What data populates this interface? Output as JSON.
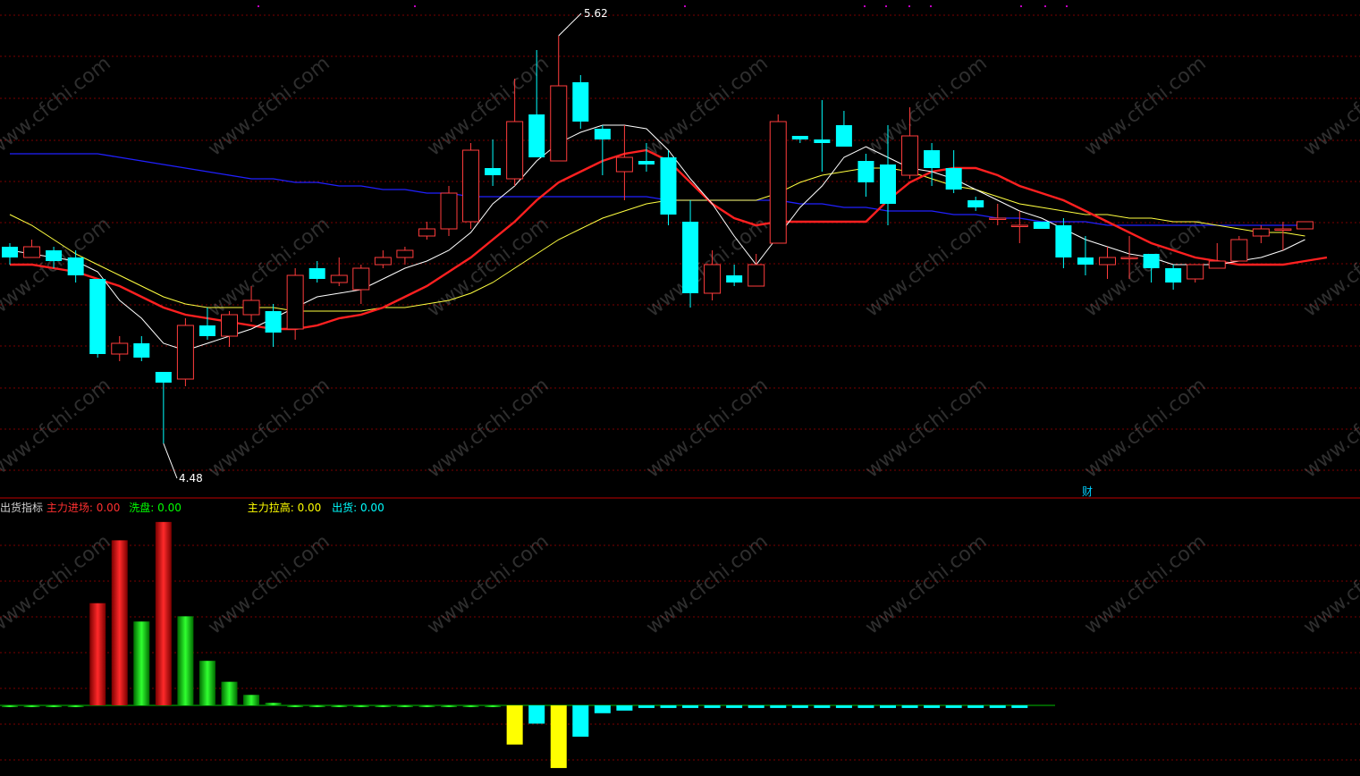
{
  "colors": {
    "background": "#000000",
    "bull_candle": "#ff3c3c",
    "bear_candle": "#00ffff",
    "ma_white": "#ffffff",
    "ma_red": "#ff2020",
    "ma_yellow": "#ffff40",
    "ma_blue": "#2020ff",
    "grid": "#7a0000",
    "divider": "#c00000",
    "osc_red": "#e00000",
    "osc_green": "#00d000",
    "osc_yellow": "#ffff00",
    "osc_cyan": "#00ffff",
    "text_red": "#ff3030",
    "text_green": "#00ff00",
    "text_yellow": "#ffff00",
    "text_cyan": "#00ffff",
    "text_white": "#d0d0d0"
  },
  "watermark": "www.cfchi.com",
  "indicator": {
    "name": "出货指标",
    "main_entry_label": "主力进场:",
    "main_entry_value": "0.00",
    "wash_label": "洗盘:",
    "wash_value": "0.00",
    "pull_up_label": "主力拉高:",
    "pull_up_value": "0.00",
    "ship_label": "出货:",
    "ship_value": "0.00"
  },
  "annotations": {
    "high_label": "5.62",
    "low_label": "4.48",
    "finance_marker": "财"
  },
  "chart_data": [
    {
      "type": "candlestick",
      "ylim": [
        4.35,
        5.7
      ],
      "candles": [
        {
          "o": 5.03,
          "h": 5.04,
          "l": 4.98,
          "c": 5.0
        },
        {
          "o": 5.0,
          "h": 5.05,
          "l": 5.0,
          "c": 5.03
        },
        {
          "o": 5.02,
          "h": 5.03,
          "l": 4.97,
          "c": 4.99
        },
        {
          "o": 5.0,
          "h": 5.02,
          "l": 4.93,
          "c": 4.95
        },
        {
          "o": 4.94,
          "h": 4.94,
          "l": 4.72,
          "c": 4.73
        },
        {
          "o": 4.73,
          "h": 4.78,
          "l": 4.71,
          "c": 4.76
        },
        {
          "o": 4.76,
          "h": 4.78,
          "l": 4.71,
          "c": 4.72
        },
        {
          "o": 4.68,
          "h": 4.68,
          "l": 4.48,
          "c": 4.65
        },
        {
          "o": 4.66,
          "h": 4.83,
          "l": 4.64,
          "c": 4.81
        },
        {
          "o": 4.81,
          "h": 4.86,
          "l": 4.77,
          "c": 4.78
        },
        {
          "o": 4.78,
          "h": 4.85,
          "l": 4.75,
          "c": 4.84
        },
        {
          "o": 4.84,
          "h": 4.92,
          "l": 4.82,
          "c": 4.88
        },
        {
          "o": 4.85,
          "h": 4.87,
          "l": 4.75,
          "c": 4.79
        },
        {
          "o": 4.8,
          "h": 4.97,
          "l": 4.77,
          "c": 4.95
        },
        {
          "o": 4.97,
          "h": 4.99,
          "l": 4.93,
          "c": 4.94
        },
        {
          "o": 4.93,
          "h": 5.0,
          "l": 4.92,
          "c": 4.95
        },
        {
          "o": 4.91,
          "h": 4.98,
          "l": 4.87,
          "c": 4.97
        },
        {
          "o": 4.98,
          "h": 5.02,
          "l": 4.97,
          "c": 5.0
        },
        {
          "o": 5.0,
          "h": 5.03,
          "l": 4.98,
          "c": 5.02
        },
        {
          "o": 5.06,
          "h": 5.1,
          "l": 5.05,
          "c": 5.08
        },
        {
          "o": 5.08,
          "h": 5.2,
          "l": 5.06,
          "c": 5.18
        },
        {
          "o": 5.1,
          "h": 5.32,
          "l": 5.08,
          "c": 5.3
        },
        {
          "o": 5.25,
          "h": 5.33,
          "l": 5.2,
          "c": 5.23
        },
        {
          "o": 5.22,
          "h": 5.5,
          "l": 5.2,
          "c": 5.38
        },
        {
          "o": 5.4,
          "h": 5.58,
          "l": 5.37,
          "c": 5.28
        },
        {
          "o": 5.27,
          "h": 5.62,
          "l": 5.27,
          "c": 5.48
        },
        {
          "o": 5.49,
          "h": 5.51,
          "l": 5.36,
          "c": 5.38
        },
        {
          "o": 5.36,
          "h": 5.37,
          "l": 5.23,
          "c": 5.33
        },
        {
          "o": 5.24,
          "h": 5.37,
          "l": 5.16,
          "c": 5.28
        },
        {
          "o": 5.27,
          "h": 5.32,
          "l": 5.24,
          "c": 5.26
        },
        {
          "o": 5.28,
          "h": 5.3,
          "l": 5.09,
          "c": 5.12
        },
        {
          "o": 5.1,
          "h": 5.16,
          "l": 4.86,
          "c": 4.9
        },
        {
          "o": 4.9,
          "h": 5.02,
          "l": 4.88,
          "c": 4.98
        },
        {
          "o": 4.95,
          "h": 4.98,
          "l": 4.92,
          "c": 4.93
        },
        {
          "o": 4.92,
          "h": 5.01,
          "l": 4.92,
          "c": 4.98
        },
        {
          "o": 5.04,
          "h": 5.4,
          "l": 5.04,
          "c": 5.38
        },
        {
          "o": 5.34,
          "h": 5.32,
          "l": 5.33,
          "c": 5.33
        },
        {
          "o": 5.33,
          "h": 5.44,
          "l": 5.24,
          "c": 5.32
        },
        {
          "o": 5.37,
          "h": 5.41,
          "l": 5.31,
          "c": 5.31
        },
        {
          "o": 5.27,
          "h": 5.29,
          "l": 5.17,
          "c": 5.21
        },
        {
          "o": 5.26,
          "h": 5.37,
          "l": 5.09,
          "c": 5.15
        },
        {
          "o": 5.23,
          "h": 5.42,
          "l": 5.22,
          "c": 5.34
        },
        {
          "o": 5.3,
          "h": 5.32,
          "l": 5.2,
          "c": 5.25
        },
        {
          "o": 5.25,
          "h": 5.3,
          "l": 5.18,
          "c": 5.19
        },
        {
          "o": 5.16,
          "h": 5.17,
          "l": 5.13,
          "c": 5.14
        },
        {
          "o": 5.11,
          "h": 5.15,
          "l": 5.09,
          "c": 5.11
        },
        {
          "o": 5.09,
          "h": 5.13,
          "l": 5.04,
          "c": 5.09
        },
        {
          "o": 5.1,
          "h": 5.1,
          "l": 5.08,
          "c": 5.08
        },
        {
          "o": 5.09,
          "h": 5.11,
          "l": 4.97,
          "c": 5.0
        },
        {
          "o": 5.0,
          "h": 5.06,
          "l": 4.95,
          "c": 4.98
        },
        {
          "o": 4.98,
          "h": 5.03,
          "l": 4.94,
          "c": 5.0
        },
        {
          "o": 5.0,
          "h": 5.06,
          "l": 4.94,
          "c": 5.0
        },
        {
          "o": 5.01,
          "h": 5.01,
          "l": 4.93,
          "c": 4.97
        },
        {
          "o": 4.97,
          "h": 4.98,
          "l": 4.91,
          "c": 4.93
        },
        {
          "o": 4.94,
          "h": 4.98,
          "l": 4.93,
          "c": 4.98
        },
        {
          "o": 4.97,
          "h": 5.04,
          "l": 4.97,
          "c": 4.99
        },
        {
          "o": 4.99,
          "h": 5.06,
          "l": 4.99,
          "c": 5.05
        },
        {
          "o": 5.06,
          "h": 5.09,
          "l": 5.04,
          "c": 5.08
        },
        {
          "o": 5.08,
          "h": 5.1,
          "l": 5.02,
          "c": 5.08
        },
        {
          "o": 5.08,
          "h": 5.1,
          "l": 5.09,
          "c": 5.1
        }
      ],
      "ma_white": [
        5.02,
        5.01,
        5.0,
        4.99,
        4.96,
        4.88,
        4.83,
        4.76,
        4.74,
        4.76,
        4.78,
        4.8,
        4.83,
        4.86,
        4.89,
        4.9,
        4.91,
        4.94,
        4.97,
        4.99,
        5.02,
        5.07,
        5.15,
        5.2,
        5.27,
        5.32,
        5.35,
        5.37,
        5.37,
        5.36,
        5.3,
        5.22,
        5.15,
        5.06,
        4.98,
        5.06,
        5.14,
        5.2,
        5.28,
        5.31,
        5.28,
        5.25,
        5.24,
        5.22,
        5.19,
        5.16,
        5.13,
        5.11,
        5.08,
        5.05,
        5.03,
        5.01,
        5.0,
        4.98,
        4.98,
        4.98,
        4.99,
        5.0,
        5.02,
        5.05
      ],
      "ma_red": [
        4.98,
        4.98,
        4.97,
        4.96,
        4.94,
        4.92,
        4.89,
        4.86,
        4.84,
        4.83,
        4.82,
        4.81,
        4.8,
        4.8,
        4.81,
        4.83,
        4.84,
        4.86,
        4.89,
        4.92,
        4.96,
        5.0,
        5.05,
        5.1,
        5.16,
        5.21,
        5.24,
        5.27,
        5.29,
        5.3,
        5.27,
        5.21,
        5.15,
        5.11,
        5.09,
        5.1,
        5.1,
        5.1,
        5.1,
        5.1,
        5.16,
        5.21,
        5.24,
        5.25,
        5.25,
        5.23,
        5.2,
        5.18,
        5.16,
        5.13,
        5.1,
        5.07,
        5.04,
        5.02,
        5.0,
        4.99,
        4.98,
        4.98,
        4.98,
        4.99,
        5.0
      ],
      "ma_yellow": [
        5.12,
        5.09,
        5.05,
        5.01,
        4.98,
        4.95,
        4.92,
        4.89,
        4.87,
        4.86,
        4.86,
        4.86,
        4.86,
        4.85,
        4.85,
        4.85,
        4.85,
        4.86,
        4.86,
        4.87,
        4.88,
        4.9,
        4.93,
        4.97,
        5.01,
        5.05,
        5.08,
        5.11,
        5.13,
        5.15,
        5.16,
        5.16,
        5.16,
        5.16,
        5.16,
        5.18,
        5.21,
        5.23,
        5.24,
        5.25,
        5.25,
        5.24,
        5.22,
        5.2,
        5.19,
        5.17,
        5.15,
        5.14,
        5.13,
        5.12,
        5.12,
        5.11,
        5.11,
        5.1,
        5.1,
        5.09,
        5.08,
        5.07,
        5.07,
        5.06
      ],
      "ma_blue": [
        5.29,
        5.29,
        5.29,
        5.29,
        5.29,
        5.28,
        5.27,
        5.26,
        5.25,
        5.24,
        5.23,
        5.22,
        5.22,
        5.21,
        5.21,
        5.2,
        5.2,
        5.19,
        5.19,
        5.18,
        5.18,
        5.17,
        5.17,
        5.17,
        5.17,
        5.17,
        5.17,
        5.17,
        5.17,
        5.17,
        5.16,
        5.16,
        5.16,
        5.16,
        5.16,
        5.16,
        5.15,
        5.15,
        5.14,
        5.14,
        5.13,
        5.13,
        5.13,
        5.12,
        5.12,
        5.11,
        5.11,
        5.1,
        5.1,
        5.1,
        5.09,
        5.09,
        5.09,
        5.09,
        5.09,
        5.09,
        5.09,
        5.09,
        5.09,
        5.09
      ]
    },
    {
      "type": "bar",
      "series_labels": [
        "主力进场",
        "洗盘",
        "主力拉高",
        "出货"
      ],
      "values": [
        0,
        0,
        0,
        0,
        0.39,
        0.63,
        0.32,
        0.7,
        0.34,
        0.17,
        0.09,
        0.04,
        0.01,
        0,
        0,
        0,
        0,
        0,
        0,
        0,
        0,
        0,
        0,
        -0.15,
        -0.07,
        -0.24,
        -0.12,
        -0.03,
        -0.02,
        -0.01,
        -0.01,
        -0.01,
        -0.01,
        -0.01,
        -0.01,
        -0.01,
        -0.01,
        -0.01,
        -0.01,
        -0.01,
        -0.01,
        -0.01,
        -0.01,
        -0.01,
        -0.01,
        -0.01,
        -0.01
      ],
      "colors": [
        "green",
        "green",
        "green",
        "green",
        "red",
        "red",
        "green",
        "red",
        "green",
        "green",
        "green",
        "green",
        "green",
        "green",
        "green",
        "green",
        "green",
        "green",
        "green",
        "green",
        "green",
        "green",
        "green",
        "yellow",
        "cyan",
        "yellow",
        "cyan",
        "cyan",
        "cyan",
        "cyan",
        "cyan",
        "cyan",
        "cyan",
        "cyan",
        "cyan",
        "cyan",
        "cyan",
        "cyan",
        "cyan",
        "cyan",
        "cyan",
        "cyan",
        "cyan",
        "cyan",
        "cyan",
        "cyan",
        "cyan"
      ],
      "ylim": [
        -0.25,
        0.72
      ]
    }
  ]
}
